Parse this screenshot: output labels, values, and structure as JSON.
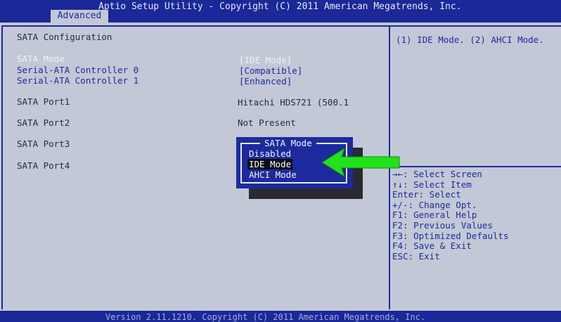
{
  "header": {
    "title": "Aptio Setup Utility - Copyright (C) 2011 American Megatrends, Inc.",
    "active_tab": "Advanced"
  },
  "section_title": "SATA Configuration",
  "settings": [
    {
      "label": "SATA Mode",
      "value": "[IDE Mode]"
    },
    {
      "label": "Serial-ATA Controller 0",
      "value": "[Compatible]"
    },
    {
      "label": "Serial-ATA Controller 1",
      "value": "[Enhanced]"
    }
  ],
  "ports": [
    {
      "label": "SATA Port1",
      "value": "Hitachi HDS721 (500.1"
    },
    {
      "label": "SATA Port2",
      "value": "Not Present"
    },
    {
      "label": "SATA Port3",
      "value": ""
    },
    {
      "label": "SATA Port4",
      "value": ""
    }
  ],
  "help_text": "(1) IDE Mode. (2) AHCI Mode.",
  "popup": {
    "title": "SATA Mode",
    "options": [
      "Disabled",
      "IDE Mode",
      "AHCI Mode"
    ],
    "selected_index": 1
  },
  "key_help": [
    "→←: Select Screen",
    "↑↓: Select Item",
    "Enter: Select",
    "+/-: Change Opt.",
    "F1: General Help",
    "F2: Previous Values",
    "F3: Optimized Defaults",
    "F4: Save & Exit",
    "ESC: Exit"
  ],
  "footer": "Version 2.11.1210. Copyright (C) 2011 American Megatrends, Inc.",
  "colors": {
    "background": "#1d2a9e",
    "panel": "#c3c8d6",
    "arrow": "#22e21a"
  }
}
